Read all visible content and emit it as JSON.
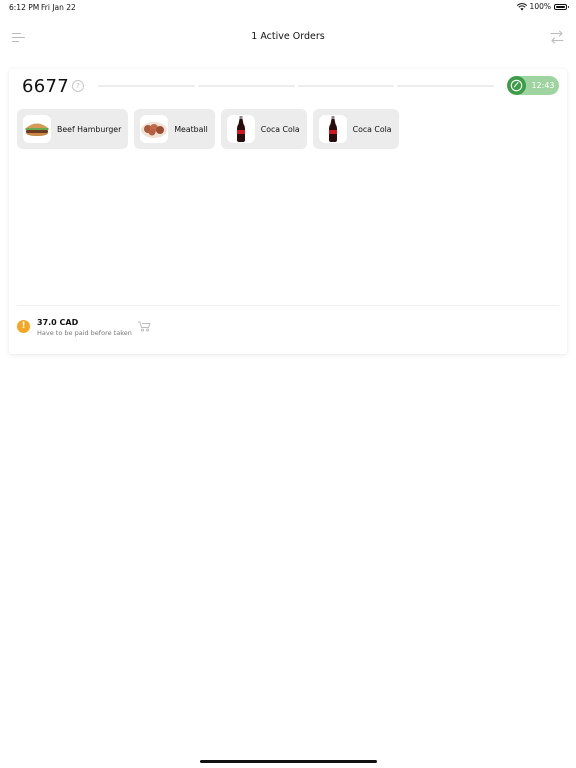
{
  "status_bar": {
    "time": "6:12 PM",
    "date": "Fri Jan 22",
    "battery": "100%",
    "wifi_icon": "wifi-icon",
    "battery_icon": "battery-icon"
  },
  "header": {
    "title": "1 Active Orders",
    "menu_icon": "menu-icon",
    "filter_icon": "filter-swap-icon"
  },
  "order": {
    "number": "6677",
    "help_icon": "question-circle-icon",
    "timer": "12:43",
    "timer_icon": "clock-check-icon",
    "progress_segments": 4,
    "items": [
      {
        "label": "Beef Hamburger",
        "icon": "burger-icon"
      },
      {
        "label": "Meatball",
        "icon": "meat-plate-icon"
      },
      {
        "label": "Coca Cola",
        "icon": "cola-bottle-icon"
      },
      {
        "label": "Coca Cola",
        "icon": "cola-bottle-icon"
      }
    ],
    "price": "37.0 CAD",
    "payment_note": "Have to be paid before taken",
    "warning_icon": "warning-icon",
    "delivery_icon": "delivery-cart-icon"
  },
  "colors": {
    "accent_green": "#3d9c48",
    "timer_bg": "#9fd39f",
    "warning": "#f5a623",
    "chip_bg": "#ececec"
  }
}
